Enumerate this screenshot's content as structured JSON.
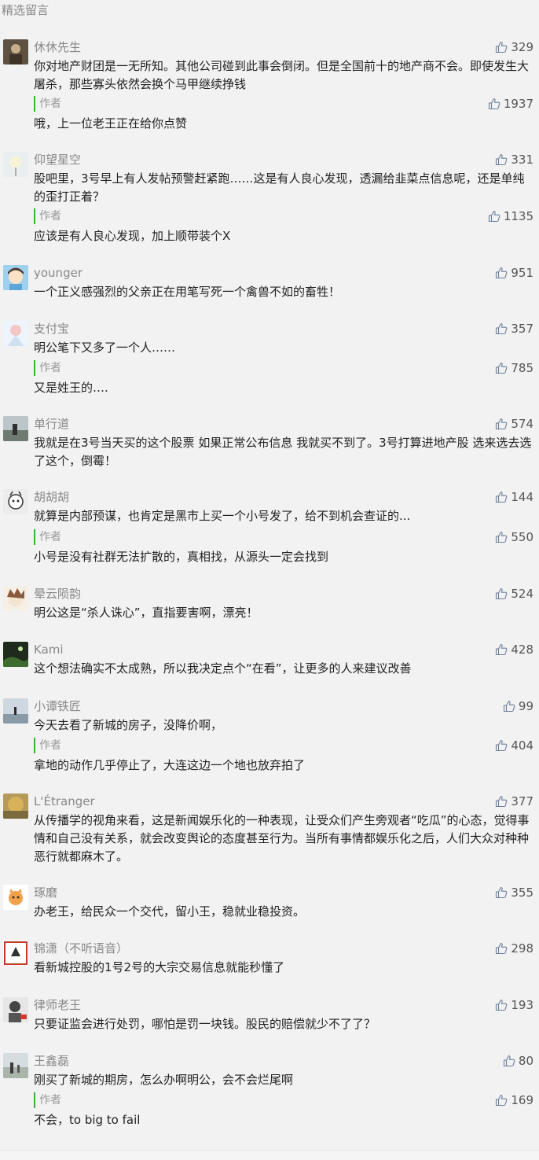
{
  "section_title": "精选留言",
  "author_label": "作者",
  "comments": [
    {
      "nickname": "休休先生",
      "text": "你对地产财团是一无所知。其他公司碰到此事会倒闭。但是全国前十的地产商不会。即使发生大屠杀，那些寡头依然会换个马甲继续挣钱",
      "likes": "329",
      "reply": {
        "text": "哦，上一位老王正在给你点赞",
        "likes": "1937"
      }
    },
    {
      "nickname": "仰望星空",
      "text": "股吧里，3号早上有人发帖预警赶紧跑……这是有人良心发现，透漏给韭菜点信息呢，还是单纯的歪打正着？",
      "likes": "331",
      "reply": {
        "text": "应该是有人良心发现，加上顺带装个X",
        "likes": "1135"
      }
    },
    {
      "nickname": "younger",
      "text": "一个正义感强烈的父亲正在用笔写死一个禽兽不如的畜牲！",
      "likes": "951"
    },
    {
      "nickname": "支付宝",
      "text": "明公笔下又多了一个人……",
      "likes": "357",
      "reply": {
        "text": "又是姓王的….",
        "likes": "785"
      }
    },
    {
      "nickname": "单行道",
      "text": "我就是在3号当天买的这个股票  如果正常公布信息 我就买不到了。3号打算进地产股 选来选去选了这个，倒霉！",
      "likes": "574"
    },
    {
      "nickname": "胡胡胡",
      "text": "就算是内部预谋，也肯定是黑市上买一个小号发了，给不到机会查证的...",
      "likes": "144",
      "reply": {
        "text": "小号是没有社群无法扩散的，真相找，从源头一定会找到",
        "likes": "550"
      }
    },
    {
      "nickname": "晕云陨韵",
      "text": "明公这是“杀人诛心”，直指要害啊，漂亮！",
      "likes": "524"
    },
    {
      "nickname": "Kami",
      "text": "这个想法确实不太成熟，所以我决定点个“在看”，让更多的人来建议改善",
      "likes": "428"
    },
    {
      "nickname": "小谭铁匠",
      "text": "今天去看了新城的房子，没降价啊，",
      "likes": "99",
      "reply": {
        "text": "拿地的动作几乎停止了，大连这边一个地也放弃拍了",
        "likes": "404"
      }
    },
    {
      "nickname": "L'Étranger",
      "text": "从传播学的视角来看，这是新闻娱乐化的一种表现，让受众们产生旁观者“吃瓜”的心态，觉得事情和自己没有关系，就会改变舆论的态度甚至行为。当所有事情都娱乐化之后，人们大众对种种恶行就都麻木了。",
      "likes": "377"
    },
    {
      "nickname": "琢磨",
      "text": "办老王，给民众一个交代，留小王，稳就业稳投资。",
      "likes": "355"
    },
    {
      "nickname": "锦潇（不听语音）",
      "text": "看新城控股的1号2号的大宗交易信息就能秒懂了",
      "likes": "298"
    },
    {
      "nickname": "律师老王",
      "text": "只要证监会进行处罚，哪怕是罚一块钱。股民的赔偿就少不了了？",
      "likes": "193"
    },
    {
      "nickname": "王鑫磊",
      "text": "刚买了新城的期房，怎么办啊明公，会不会烂尾啊",
      "likes": "80",
      "reply": {
        "text": "不会，to big to fail",
        "likes": "169"
      }
    }
  ],
  "colors": {
    "author_bar": "#3cb035",
    "background": "#f2f2f2"
  },
  "icons": {
    "like": "thumbs-up-icon"
  }
}
